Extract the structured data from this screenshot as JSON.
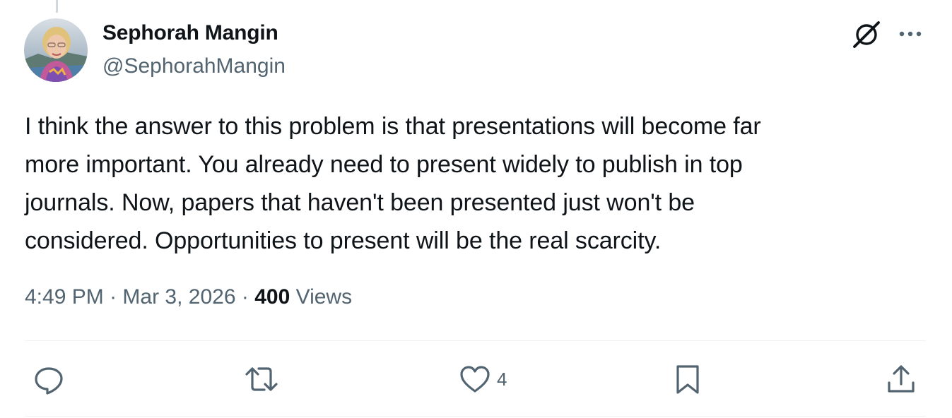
{
  "tweet": {
    "author": {
      "name": "Sephorah Mangin",
      "handle": "@SephorahMangin"
    },
    "text_lines": [
      "I think the answer to this problem is that presentations will become far",
      "more important. You already need to present widely to publish in top",
      "journals. Now, papers that haven't been presented just won't be",
      "considered. Opportunities to present will be the real scarcity."
    ],
    "meta": {
      "time": "4:49 PM",
      "separator": "·",
      "date": "Mar 3, 2026",
      "views_count": "400",
      "views_label": "Views"
    },
    "actions": {
      "reply_icon": "speech-bubble-icon",
      "retweet_icon": "retweet-arrows-icon",
      "like_icon": "heart-icon",
      "like_count": "4",
      "bookmark_icon": "bookmark-icon",
      "share_icon": "upload-share-icon"
    },
    "header_icons": {
      "grok": "grok-slash-circle-icon",
      "more": "more-dots-icon"
    }
  },
  "colors": {
    "text_primary": "#0f1419",
    "text_secondary": "#536471",
    "divider": "#eff3f4",
    "thread_line": "#cfd9de"
  }
}
